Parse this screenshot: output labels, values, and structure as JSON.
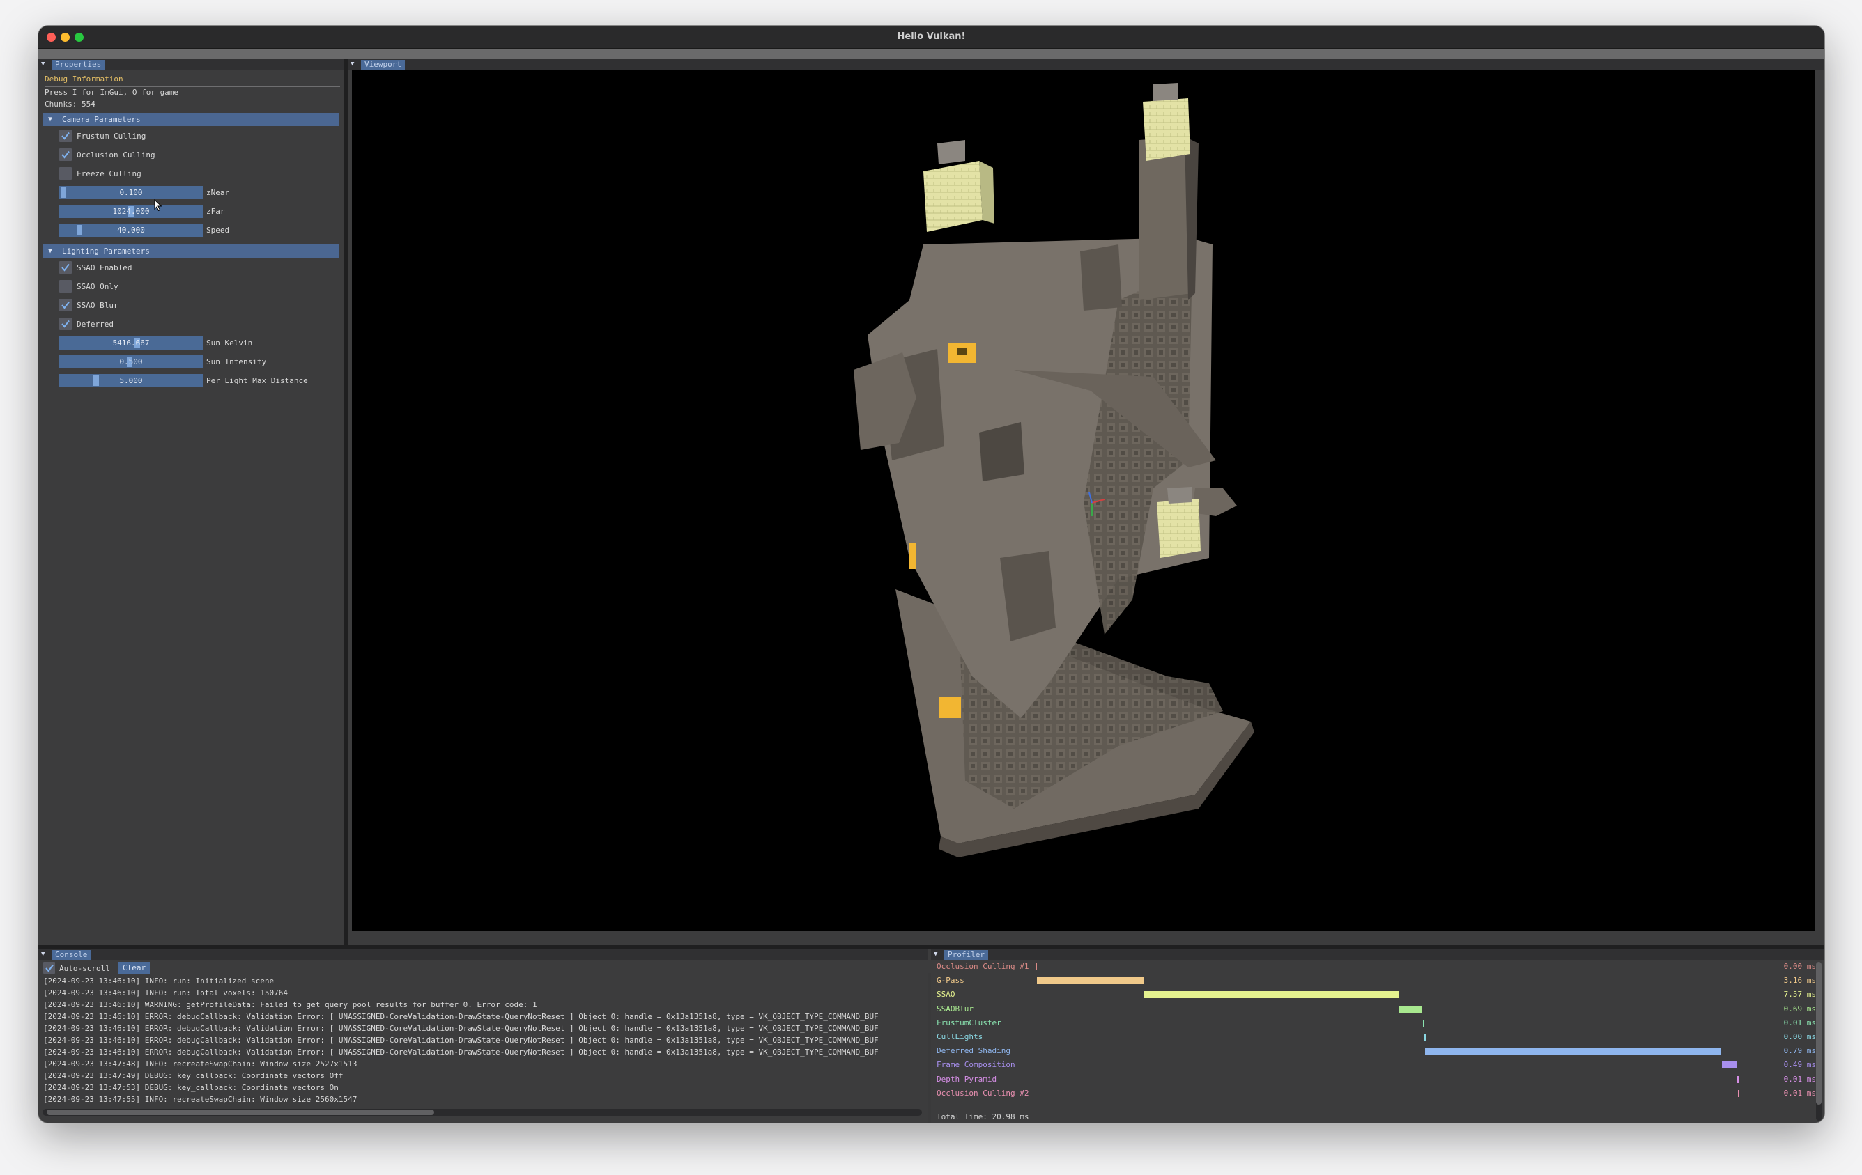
{
  "window": {
    "title": "Hello Vulkan!"
  },
  "properties": {
    "tab": "Properties",
    "debug_header": "Debug Information",
    "hint": "Press I for ImGui, O for game",
    "chunks": "Chunks: 554",
    "camera_header": "Camera Parameters",
    "camera_checks": [
      {
        "label": "Frustum Culling",
        "checked": true
      },
      {
        "label": "Occlusion Culling",
        "checked": true
      },
      {
        "label": "Freeze Culling",
        "checked": false
      }
    ],
    "camera_sliders": [
      {
        "value": "0.100",
        "label": "zNear",
        "fraction": 0.02
      },
      {
        "value": "1024.000",
        "label": "zFar",
        "fraction": 0.5
      },
      {
        "value": "40.000",
        "label": "Speed",
        "fraction": 0.12
      }
    ],
    "lighting_header": "Lighting Parameters",
    "lighting_checks": [
      {
        "label": "SSAO Enabled",
        "checked": true
      },
      {
        "label": "SSAO Only",
        "checked": false
      },
      {
        "label": "SSAO Blur",
        "checked": true
      },
      {
        "label": "Deferred",
        "checked": true
      }
    ],
    "lighting_sliders": [
      {
        "value": "5416.667",
        "label": "Sun Kelvin",
        "fraction": 0.55
      },
      {
        "value": "0.500",
        "label": "Sun Intensity",
        "fraction": 0.5
      },
      {
        "value": "5.000",
        "label": "Per Light Max Distance",
        "fraction": 0.25
      }
    ]
  },
  "viewport": {
    "tab": "Viewport"
  },
  "console": {
    "tab": "Console",
    "autoscroll_label": "Auto-scroll",
    "clear_label": "Clear",
    "lines": [
      "[2024-09-23 13:46:10] INFO: run: Initialized scene",
      "[2024-09-23 13:46:10] INFO: run: Total voxels: 150764",
      "[2024-09-23 13:46:10] WARNING: getProfileData: Failed to get query pool results for buffer 0. Error code: 1",
      "[2024-09-23 13:46:10] ERROR: debugCallback: Validation Error: [ UNASSIGNED-CoreValidation-DrawState-QueryNotReset ] Object 0: handle = 0x13a1351a8, type = VK_OBJECT_TYPE_COMMAND_BUF",
      "[2024-09-23 13:46:10] ERROR: debugCallback: Validation Error: [ UNASSIGNED-CoreValidation-DrawState-QueryNotReset ] Object 0: handle = 0x13a1351a8, type = VK_OBJECT_TYPE_COMMAND_BUF",
      "[2024-09-23 13:46:10] ERROR: debugCallback: Validation Error: [ UNASSIGNED-CoreValidation-DrawState-QueryNotReset ] Object 0: handle = 0x13a1351a8, type = VK_OBJECT_TYPE_COMMAND_BUF",
      "[2024-09-23 13:46:10] ERROR: debugCallback: Validation Error: [ UNASSIGNED-CoreValidation-DrawState-QueryNotReset ] Object 0: handle = 0x13a1351a8, type = VK_OBJECT_TYPE_COMMAND_BUF",
      "[2024-09-23 13:47:48] INFO: recreateSwapChain: Window size 2527x1513",
      "[2024-09-23 13:47:49] DEBUG: key_callback: Coordinate vectors Off",
      "[2024-09-23 13:47:53] DEBUG: key_callback: Coordinate vectors On",
      "[2024-09-23 13:47:55] INFO: recreateSwapChain: Window size 2560x1547"
    ]
  },
  "profiler": {
    "tab": "Profiler",
    "rows": [
      {
        "label": "Occlusion Culling #1",
        "value": "0.00 ms",
        "color": "#d88a86",
        "start": 0.0,
        "width": 0.0016
      },
      {
        "label": "G-Pass",
        "value": "3.16 ms",
        "color": "#f0c98a",
        "start": 0.0016,
        "width": 0.152
      },
      {
        "label": "SSAO",
        "value": "7.57 ms",
        "color": "#e5f28f",
        "start": 0.154,
        "width": 0.363
      },
      {
        "label": "SSAOBlur",
        "value": "0.69 ms",
        "color": "#a8e88f",
        "start": 0.517,
        "width": 0.033
      },
      {
        "label": "FrustumCluster",
        "value": "0.01 ms",
        "color": "#8ae3b0",
        "start": 0.55,
        "width": 0.001
      },
      {
        "label": "CullLights",
        "value": "0.00 ms",
        "color": "#8ad8e3",
        "start": 0.551,
        "width": 0.003
      },
      {
        "label": "Deferred Shading",
        "value": "0.79 ms",
        "color": "#8fb6ee",
        "start": 0.553,
        "width": 0.421
      },
      {
        "label": "Frame Composition",
        "value": "0.49 ms",
        "color": "#a88fee",
        "start": 0.975,
        "width": 0.022
      },
      {
        "label": "Depth Pyramid",
        "value": "0.01 ms",
        "color": "#d68fe6",
        "start": 0.997,
        "width": 0.001
      },
      {
        "label": "Occlusion Culling #2",
        "value": "0.01 ms",
        "color": "#e88fb0",
        "start": 0.998,
        "width": 0.002
      }
    ],
    "total": "Total Time: 20.98 ms"
  }
}
